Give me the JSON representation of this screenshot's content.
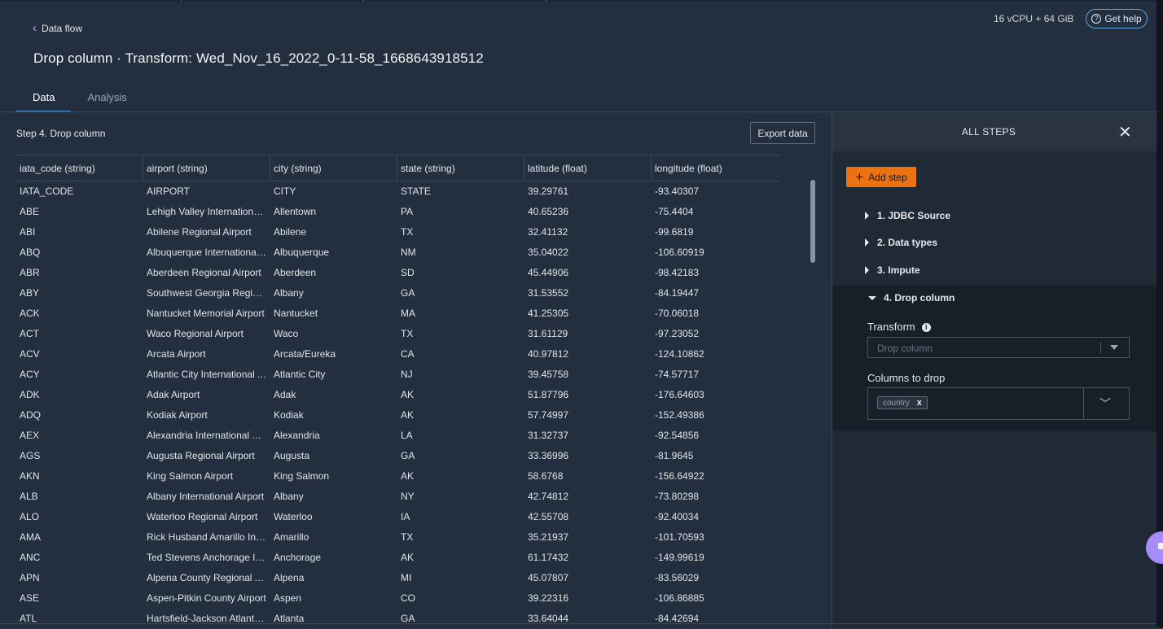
{
  "header": {
    "back_label": "Data flow",
    "title": "Drop column · Transform: Wed_Nov_16_2022_0-11-58_1668643918512",
    "resources": "16 vCPU + 64 GiB",
    "help_label": "Get help"
  },
  "tabs": [
    {
      "label": "Data",
      "active": true
    },
    {
      "label": "Analysis",
      "active": false
    }
  ],
  "data_view": {
    "step_label": "Step 4. Drop column",
    "export_label": "Export data",
    "columns": [
      "iata_code (string)",
      "airport (string)",
      "city (string)",
      "state (string)",
      "latitude (float)",
      "longitude (float)"
    ],
    "rows": [
      [
        "IATA_CODE",
        "AIRPORT",
        "CITY",
        "STATE",
        "39.29761",
        "-93.40307"
      ],
      [
        "ABE",
        "Lehigh Valley International Airport",
        "Allentown",
        "PA",
        "40.65236",
        "-75.4404"
      ],
      [
        "ABI",
        "Abilene Regional Airport",
        "Abilene",
        "TX",
        "32.41132",
        "-99.6819"
      ],
      [
        "ABQ",
        "Albuquerque International Sunport",
        "Albuquerque",
        "NM",
        "35.04022",
        "-106.60919"
      ],
      [
        "ABR",
        "Aberdeen Regional Airport",
        "Aberdeen",
        "SD",
        "45.44906",
        "-98.42183"
      ],
      [
        "ABY",
        "Southwest Georgia Regional Airport",
        "Albany",
        "GA",
        "31.53552",
        "-84.19447"
      ],
      [
        "ACK",
        "Nantucket Memorial Airport",
        "Nantucket",
        "MA",
        "41.25305",
        "-70.06018"
      ],
      [
        "ACT",
        "Waco Regional Airport",
        "Waco",
        "TX",
        "31.61129",
        "-97.23052"
      ],
      [
        "ACV",
        "Arcata Airport",
        "Arcata/Eureka",
        "CA",
        "40.97812",
        "-124.10862"
      ],
      [
        "ACY",
        "Atlantic City International Airport",
        "Atlantic City",
        "NJ",
        "39.45758",
        "-74.57717"
      ],
      [
        "ADK",
        "Adak Airport",
        "Adak",
        "AK",
        "51.87796",
        "-176.64603"
      ],
      [
        "ADQ",
        "Kodiak Airport",
        "Kodiak",
        "AK",
        "57.74997",
        "-152.49386"
      ],
      [
        "AEX",
        "Alexandria International Airport",
        "Alexandria",
        "LA",
        "31.32737",
        "-92.54856"
      ],
      [
        "AGS",
        "Augusta Regional Airport",
        "Augusta",
        "GA",
        "33.36996",
        "-81.9645"
      ],
      [
        "AKN",
        "King Salmon Airport",
        "King Salmon",
        "AK",
        "58.6768",
        "-156.64922"
      ],
      [
        "ALB",
        "Albany International Airport",
        "Albany",
        "NY",
        "42.74812",
        "-73.80298"
      ],
      [
        "ALO",
        "Waterloo Regional Airport",
        "Waterloo",
        "IA",
        "42.55708",
        "-92.40034"
      ],
      [
        "AMA",
        "Rick Husband Amarillo International Airport",
        "Amarillo",
        "TX",
        "35.21937",
        "-101.70593"
      ],
      [
        "ANC",
        "Ted Stevens Anchorage International Airport",
        "Anchorage",
        "AK",
        "61.17432",
        "-149.99619"
      ],
      [
        "APN",
        "Alpena County Regional Airport",
        "Alpena",
        "MI",
        "45.07807",
        "-83.56029"
      ],
      [
        "ASE",
        "Aspen-Pitkin County Airport",
        "Aspen",
        "CO",
        "39.22316",
        "-106.86885"
      ],
      [
        "ATL",
        "Hartsfield-Jackson Atlanta International Airport",
        "Atlanta",
        "GA",
        "33.64044",
        "-84.42694"
      ]
    ]
  },
  "steps_panel": {
    "title": "ALL STEPS",
    "add_step_label": "Add step",
    "steps": [
      "1. JDBC Source",
      "2. Data types",
      "3. Impute",
      "4. Drop column"
    ],
    "transform_label": "Transform",
    "transform_value": "Drop column",
    "columns_to_drop_label": "Columns to drop",
    "columns_to_drop": [
      "country"
    ]
  },
  "colors": {
    "background": "#232f3e",
    "accent_orange": "#ec7211",
    "tab_underline": "#4c8ec9"
  }
}
